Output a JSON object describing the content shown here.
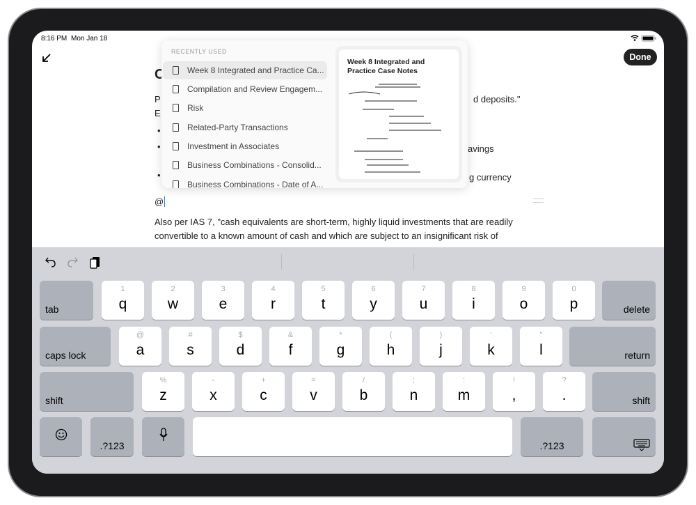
{
  "status": {
    "time": "8:16 PM",
    "date": "Mon Jan 18",
    "wifi_icon": "wifi-icon",
    "battery_icon": "battery-icon"
  },
  "toolbar": {
    "done_label": "Done",
    "collapse_icon": "arrow-down-left-icon"
  },
  "document": {
    "heading_fragment": "C",
    "line1_start": "P",
    "line1_end": "d deposits.\"",
    "line2_start": "E",
    "bullet2_end": "avings",
    "bullet3_end": "g currency",
    "typed": "@",
    "para_line1": "Also per IAS 7, \"cash equivalents are short-term, highly liquid investments that are readily",
    "para_line2": "convertible to a known amount of cash and which are subject to an insignificant risk of"
  },
  "mention_popup": {
    "section_label": "RECENTLY USED",
    "items": [
      {
        "label": "Week 8 Integrated and Practice Ca...",
        "selected": true
      },
      {
        "label": "Compilation and Review Engagem..."
      },
      {
        "label": "Risk"
      },
      {
        "label": "Related-Party Transactions"
      },
      {
        "label": "Investment in Associates"
      },
      {
        "label": "Business Combinations - Consolid..."
      },
      {
        "label": "Business Combinations - Date of A..."
      }
    ],
    "preview": {
      "title": "Week 8 Integrated and Practice Case Notes"
    }
  },
  "keyboard": {
    "shortcuts": [
      "undo-icon",
      "redo-icon",
      "paste-icon"
    ],
    "row1": [
      [
        "1",
        "q"
      ],
      [
        "2",
        "w"
      ],
      [
        "3",
        "e"
      ],
      [
        "4",
        "r"
      ],
      [
        "5",
        "t"
      ],
      [
        "6",
        "y"
      ],
      [
        "7",
        "u"
      ],
      [
        "8",
        "i"
      ],
      [
        "9",
        "o"
      ],
      [
        "0",
        "p"
      ]
    ],
    "row2": [
      [
        "@",
        "a"
      ],
      [
        "#",
        "s"
      ],
      [
        "$",
        "d"
      ],
      [
        "&",
        "f"
      ],
      [
        "*",
        "g"
      ],
      [
        "(",
        "h"
      ],
      [
        ")",
        "j"
      ],
      [
        "'",
        "k"
      ],
      [
        "\"",
        "l"
      ]
    ],
    "row3": [
      [
        "%",
        "z"
      ],
      [
        "-",
        "x"
      ],
      [
        "+",
        "c"
      ],
      [
        "=",
        "v"
      ],
      [
        "/",
        "b"
      ],
      [
        ";",
        "n"
      ],
      [
        ":",
        "m"
      ],
      [
        "!",
        ","
      ],
      [
        "?",
        "."
      ]
    ],
    "tab": "tab",
    "delete": "delete",
    "caps_lock": "caps lock",
    "return": "return",
    "shift": "shift",
    "numbers": ".?123"
  }
}
